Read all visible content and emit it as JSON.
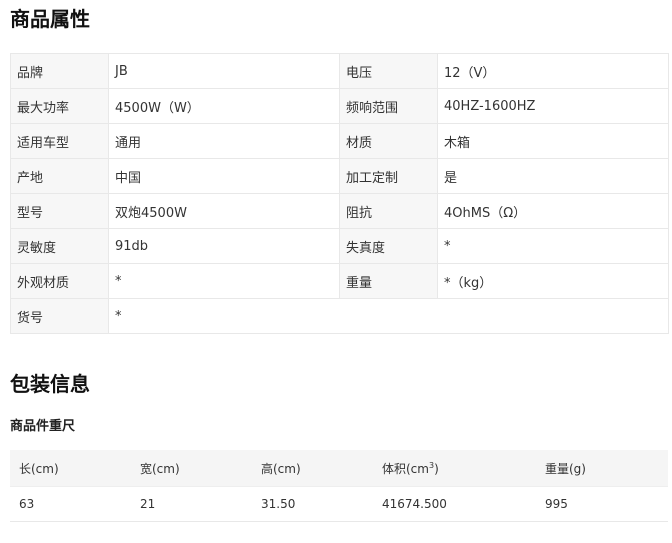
{
  "attributes": {
    "title": "商品属性",
    "rows": [
      {
        "k1": "品牌",
        "v1": "JB",
        "k2": "电压",
        "v2": "12（V）"
      },
      {
        "k1": "最大功率",
        "v1": "4500W（W）",
        "k2": "频响范围",
        "v2": "40HZ-1600HZ"
      },
      {
        "k1": "适用车型",
        "v1": "通用",
        "k2": "材质",
        "v2": "木箱"
      },
      {
        "k1": "产地",
        "v1": "中国",
        "k2": "加工定制",
        "v2": "是"
      },
      {
        "k1": "型号",
        "v1": "双炮4500W",
        "k2": "阻抗",
        "v2": "4OhMS（Ω）"
      },
      {
        "k1": "灵敏度",
        "v1": "91db",
        "k2": "失真度",
        "v2": "*"
      },
      {
        "k1": "外观材质",
        "v1": "*",
        "k2": "重量",
        "v2": "*（kg）"
      },
      {
        "k1": "货号",
        "v1": "*"
      }
    ]
  },
  "packaging": {
    "title": "包装信息",
    "subtitle": "商品件重尺",
    "headers": {
      "length": "长(cm)",
      "width": "宽(cm)",
      "height": "高(cm)",
      "volume": "体积(cm",
      "volume_sup": "3",
      "volume_close": ")",
      "weight": "重量(g)"
    },
    "row": {
      "length": "63",
      "width": "21",
      "height": "31.50",
      "volume": "41674.500",
      "weight": "995"
    }
  }
}
